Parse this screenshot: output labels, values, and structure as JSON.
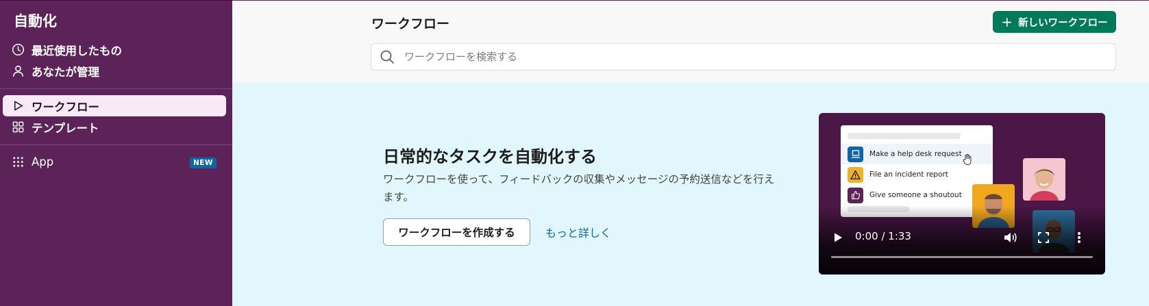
{
  "sidebar": {
    "title": "自動化",
    "items": [
      {
        "label": "最近使用したもの",
        "icon": "clock-icon"
      },
      {
        "label": "あなたが管理",
        "icon": "person-icon"
      },
      {
        "label": "ワークフロー",
        "icon": "play-icon",
        "active": true
      },
      {
        "label": "テンプレート",
        "icon": "grid-icon"
      },
      {
        "label": "App",
        "icon": "apps-icon",
        "badge": "NEW"
      }
    ]
  },
  "header": {
    "title": "ワークフロー",
    "new_button": "新しいワークフロー",
    "search_placeholder": "ワークフローを検索する"
  },
  "hero": {
    "title": "日常的なタスクを自動化する",
    "description": "ワークフローを使って、フィードバックの収集やメッセージの予約送信などを行えます。",
    "create_button": "ワークフローを作成する",
    "learn_more": "もっと詳しく"
  },
  "video": {
    "card_items": [
      {
        "label": "Make a help desk request",
        "icon": "computer-icon",
        "color": "#1264a3"
      },
      {
        "label": "File an incident report",
        "icon": "warning-icon",
        "color": "#ecb22e"
      },
      {
        "label": "Give someone a shoutout",
        "icon": "thumbs-up-icon",
        "color": "#5c2359"
      }
    ],
    "time": "0:00 / 1:33",
    "progress": 0
  },
  "colors": {
    "sidebar_bg": "#5c2359",
    "primary_button": "#007a5a",
    "hero_bg": "#e2f7fd",
    "link": "#1264a3"
  }
}
